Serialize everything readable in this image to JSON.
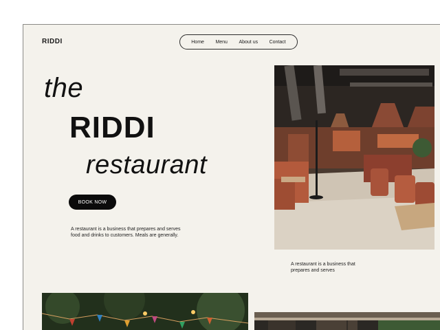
{
  "brand": {
    "logo": "RIDDI"
  },
  "nav": {
    "items": [
      {
        "label": "Home"
      },
      {
        "label": "Menu"
      },
      {
        "label": "About us"
      },
      {
        "label": "Contact"
      }
    ]
  },
  "hero": {
    "line1": "the",
    "line2": "RIDDI",
    "line3": "restaurant",
    "cta_label": "BOOK NOW",
    "description": "A restaurant is a business that prepares and serves food and drinks to customers. Meals are generally."
  },
  "feature": {
    "caption": "A restaurant is a business that prepares and serves"
  },
  "colors": {
    "background": "#f4f2ec",
    "text": "#111111",
    "button": "#0b0b0b"
  }
}
